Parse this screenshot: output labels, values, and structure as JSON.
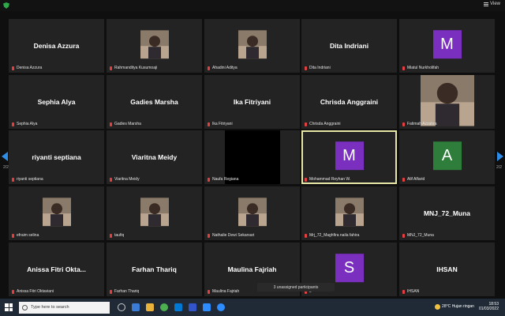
{
  "topbar": {
    "view_label": "View"
  },
  "tiles": [
    {
      "id": "t1",
      "big": "Denisa Azzura",
      "label": "Denisa Azzura",
      "kind": "name"
    },
    {
      "id": "t2",
      "big": "",
      "label": "Rahmanditya Kusumoaji",
      "kind": "photo"
    },
    {
      "id": "t3",
      "big": "",
      "label": "Ahadini Aditya",
      "kind": "photo"
    },
    {
      "id": "t4",
      "big": "Dita Indriani",
      "label": "Dita Indriani",
      "kind": "name"
    },
    {
      "id": "t5",
      "big": "M",
      "label": "Miatul Nurkholifah",
      "kind": "letter",
      "color": "#7b2fbf"
    },
    {
      "id": "t6",
      "big": "Sephia Alya",
      "label": "Sephia Alya",
      "kind": "name"
    },
    {
      "id": "t7",
      "big": "Gadies Marsha",
      "label": "Gadies Marsha",
      "kind": "name"
    },
    {
      "id": "t8",
      "big": "Ika Fitriyani",
      "label": "Ika Fitriyani",
      "kind": "name"
    },
    {
      "id": "t9",
      "big": "Chrisda Anggraini",
      "label": "Chrisda Anggraini",
      "kind": "name"
    },
    {
      "id": "t10",
      "big": "",
      "label": "Fatimah Azzahra",
      "kind": "photo-big"
    },
    {
      "id": "t11",
      "big": "riyanti septiana",
      "label": "riyanti septiana",
      "kind": "name"
    },
    {
      "id": "t12",
      "big": "Viaritna Meidy",
      "label": "Viaritna Meidy",
      "kind": "name"
    },
    {
      "id": "t13",
      "big": "",
      "label": "Naufa Regiana",
      "kind": "black"
    },
    {
      "id": "t14",
      "big": "M",
      "label": "Mohammad Reyhan W.",
      "kind": "letter",
      "color": "#7b2fbf",
      "active": true
    },
    {
      "id": "t15",
      "big": "A",
      "label": "Alif Alfarid",
      "kind": "letter",
      "color": "#2e7d3a"
    },
    {
      "id": "t16",
      "big": "",
      "label": "efraim selina",
      "kind": "photo"
    },
    {
      "id": "t17",
      "big": "",
      "label": "taufiq",
      "kind": "photo"
    },
    {
      "id": "t18",
      "big": "",
      "label": "Nathalie Dewi Sekarsari",
      "kind": "photo"
    },
    {
      "id": "t19",
      "big": "",
      "label": "Mrj_72_Maghfira naila fahira",
      "kind": "photo"
    },
    {
      "id": "t20",
      "big": "MNJ_72_Muna",
      "label": "MNJ_72_Muna",
      "kind": "name"
    },
    {
      "id": "t21",
      "big": "Anissa Fitri Okta...",
      "label": "Anissa Fitri Oktaviani",
      "kind": "name"
    },
    {
      "id": "t22",
      "big": "Farhan Thariq",
      "label": "Farhan Thariq",
      "kind": "name"
    },
    {
      "id": "t23",
      "big": "Maulina Fajriah",
      "label": "Maulina Fajriah",
      "kind": "name"
    },
    {
      "id": "t24",
      "big": "S",
      "label": "s",
      "kind": "letter",
      "color": "#7b2fbf"
    },
    {
      "id": "t25",
      "big": "IHSAN",
      "label": "IHSAN",
      "kind": "name"
    }
  ],
  "pager": {
    "left": "2/2",
    "right": "2/2"
  },
  "unassigned": "3 unassigned participants",
  "taskbar": {
    "search_placeholder": "Type here to search",
    "weather": "28°C  Hujan ringan",
    "time": "18:53",
    "date": "01/03/2022"
  },
  "colors": {
    "accent": "#2e8ce6",
    "active_border": "#e6e6a6",
    "tile_bg": "#232323"
  }
}
